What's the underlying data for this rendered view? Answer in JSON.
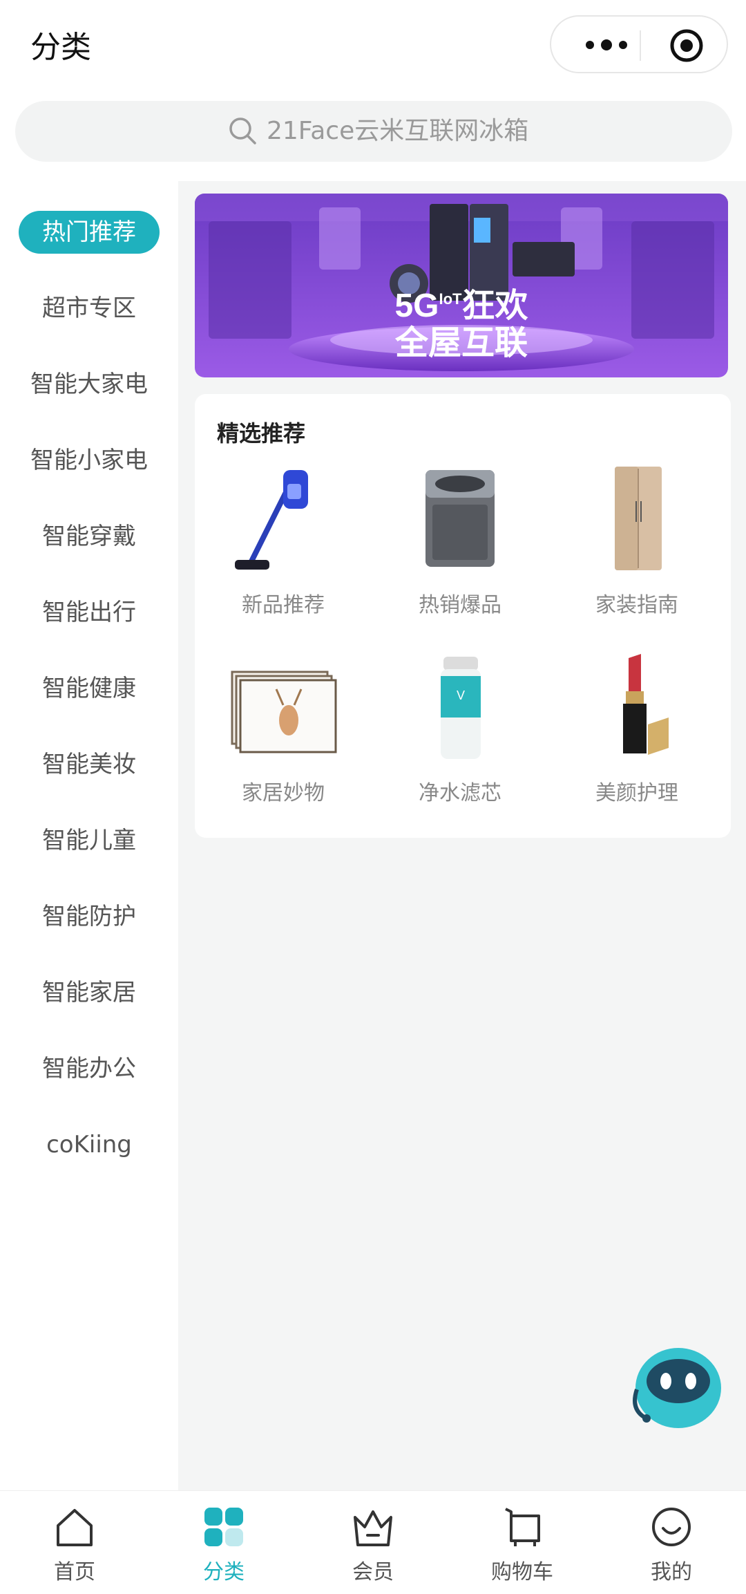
{
  "header": {
    "title": "分类"
  },
  "capsule": {
    "more_icon": "more-dots-icon",
    "target_icon": "target-icon"
  },
  "search": {
    "placeholder": "21Face云米互联网冰箱",
    "icon": "search-icon"
  },
  "sidebar": {
    "items": [
      {
        "label": "热门推荐",
        "active": true
      },
      {
        "label": "超市专区"
      },
      {
        "label": "智能大家电"
      },
      {
        "label": "智能小家电"
      },
      {
        "label": "智能穿戴"
      },
      {
        "label": "智能出行"
      },
      {
        "label": "智能健康"
      },
      {
        "label": "智能美妆"
      },
      {
        "label": "智能儿童"
      },
      {
        "label": "智能防护"
      },
      {
        "label": "智能家居"
      },
      {
        "label": "智能办公"
      },
      {
        "label": "coKiing"
      }
    ]
  },
  "banner": {
    "line1": "5G",
    "line1b": "IoT",
    "line1c": "狂欢",
    "line2": "全屋互联"
  },
  "featured": {
    "title": "精选推荐",
    "items": [
      {
        "label": "新品推荐",
        "icon": "vacuum-icon"
      },
      {
        "label": "热销爆品",
        "icon": "washing-machine-icon"
      },
      {
        "label": "家装指南",
        "icon": "refrigerator-icon"
      },
      {
        "label": "家居妙物",
        "icon": "art-frame-icon"
      },
      {
        "label": "净水滤芯",
        "icon": "water-filter-icon"
      },
      {
        "label": "美颜护理",
        "icon": "lipstick-icon"
      }
    ]
  },
  "tabbar": {
    "items": [
      {
        "label": "首页",
        "icon": "home-icon"
      },
      {
        "label": "分类",
        "icon": "category-icon",
        "active": true
      },
      {
        "label": "会员",
        "icon": "crown-icon"
      },
      {
        "label": "购物车",
        "icon": "cart-icon"
      },
      {
        "label": "我的",
        "icon": "smile-icon"
      }
    ]
  },
  "colors": {
    "accent": "#1fb1be",
    "content_bg": "#f4f5f5",
    "banner_purple": "#7b3fd0"
  }
}
